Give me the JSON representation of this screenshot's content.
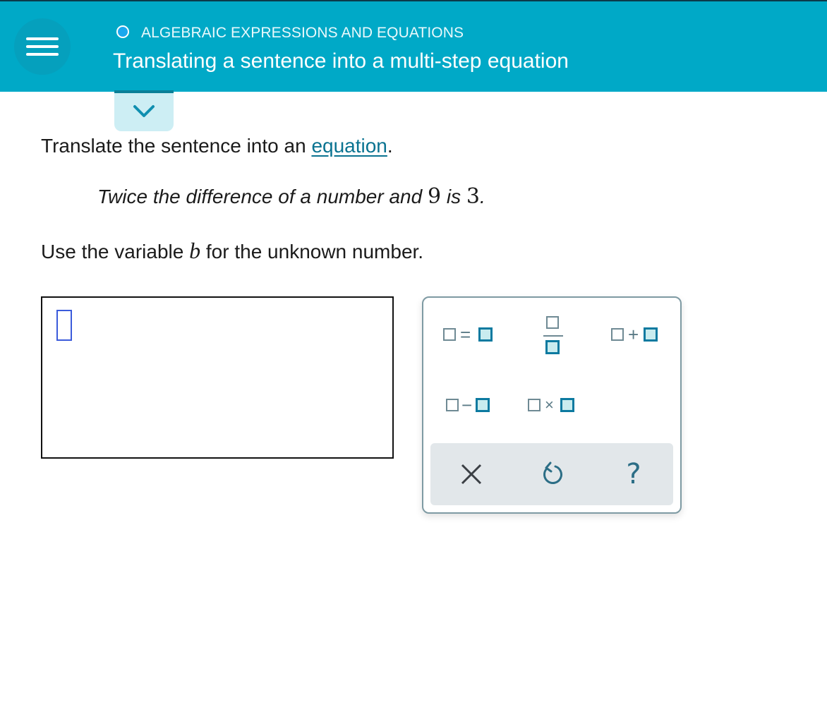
{
  "header": {
    "topic": "ALGEBRAIC EXPRESSIONS AND EQUATIONS",
    "title": "Translating a sentence into a multi-step equation",
    "icons": [
      "menu-icon",
      "topic-progress-icon"
    ],
    "colors": {
      "header_bg": "#00a9c7",
      "accent": "#0c7aa0"
    }
  },
  "collapse": {
    "icon": "chevron-down-icon"
  },
  "question": {
    "prompt_prefix": "Translate the sentence into an ",
    "prompt_link": "equation",
    "prompt_suffix": ".",
    "sentence_prefix": "Twice the difference of a number and ",
    "sentence_num1": "9",
    "sentence_mid": " is ",
    "sentence_num2": "3",
    "sentence_suffix": ".",
    "instruction_prefix": "Use the variable ",
    "instruction_var": "b",
    "instruction_suffix": " for the unknown number."
  },
  "answer": {
    "value": ""
  },
  "keypad": {
    "keys": [
      {
        "name": "equals-template",
        "op": "="
      },
      {
        "name": "fraction-template",
        "op": ""
      },
      {
        "name": "plus-template",
        "op": "+"
      },
      {
        "name": "minus-template",
        "op": "−"
      },
      {
        "name": "times-template",
        "op": "×"
      }
    ],
    "actions": [
      {
        "name": "clear",
        "icon": "close-icon"
      },
      {
        "name": "undo",
        "icon": "undo-icon"
      },
      {
        "name": "help",
        "icon": "help-icon",
        "label": "?"
      }
    ]
  }
}
